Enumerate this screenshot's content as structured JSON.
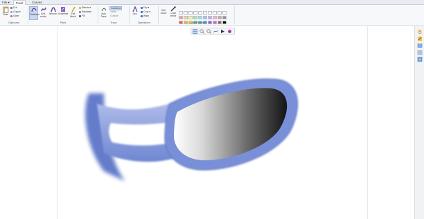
{
  "tabs": [
    {
      "label": "File ▾",
      "active": false
    },
    {
      "label": "Paint",
      "active": true
    },
    {
      "label": "Curves",
      "active": false
    }
  ],
  "clipboard": {
    "paste_label": "Paste",
    "cut_label": "Cut",
    "copy_label": "Copy ▾",
    "clear_label": "Clear",
    "group_label": "Clipboard"
  },
  "paint": {
    "tools": [
      "Freehand",
      "Soft-stroke",
      "Airbrush",
      "Scrambler"
    ],
    "fill_label": "Fill",
    "group_label": "Paint"
  },
  "paint_extra": {
    "edit_label": "Edit",
    "brush_label": "Brush",
    "effects_label": "Effects ▾",
    "replicate_label": "Replicate",
    "fill_label": "Fill"
  },
  "trace": {
    "auto_label": "Auto",
    "trace_label": "Trace",
    "centered_label": "Centered",
    "inside_label": "Inside",
    "outside_label": "Outside",
    "group_label": "Trace"
  },
  "operations": {
    "ops_label": "Ops",
    "flip_label": "Flip ▾",
    "crop_label": "Crop ▾",
    "warp_label": "Warp",
    "group_label": "Operations"
  },
  "color_palette": {
    "edit_label": "Edit",
    "colors_label": "colors",
    "load_label": "Load",
    "vector_label": "vector",
    "group_label": "Color Palette",
    "swatches": [
      "#ffffff",
      "#ffffff",
      "#ffffff",
      "#ffffff",
      "#ffffff",
      "#ffffff",
      "#ffffff",
      "#ffffff",
      "#ffffff",
      "#ffffff",
      "#ff9a9a",
      "#ffd38a",
      "#fff59a",
      "#a8e9a0",
      "#9fe6e6",
      "#9cc6f5",
      "#c9a9f0",
      "#f2b0dc",
      "#c9a98a",
      "#909090",
      "#ff5050",
      "#ffad2e",
      "#ffe52e",
      "#52c852",
      "#37c8c8",
      "#3c8de0",
      "#8a5ad8",
      "#e05cb8",
      "#8a6440",
      "#000000"
    ]
  },
  "mini_toolbar": {
    "icons": [
      "view-icon",
      "zoom-in-icon",
      "zoom-out-icon",
      "curve-icon",
      "arrow-icon",
      "color-icon"
    ]
  },
  "right_rail": {
    "icons": [
      "layers-icon",
      "brush-panel-icon",
      "image-panel-icon",
      "history-icon",
      "export-icon"
    ]
  },
  "colors": {
    "accent_blue": "#6b83d0",
    "rim_light": "#9fb0e4",
    "lens_dark": "#1a1a1a"
  }
}
